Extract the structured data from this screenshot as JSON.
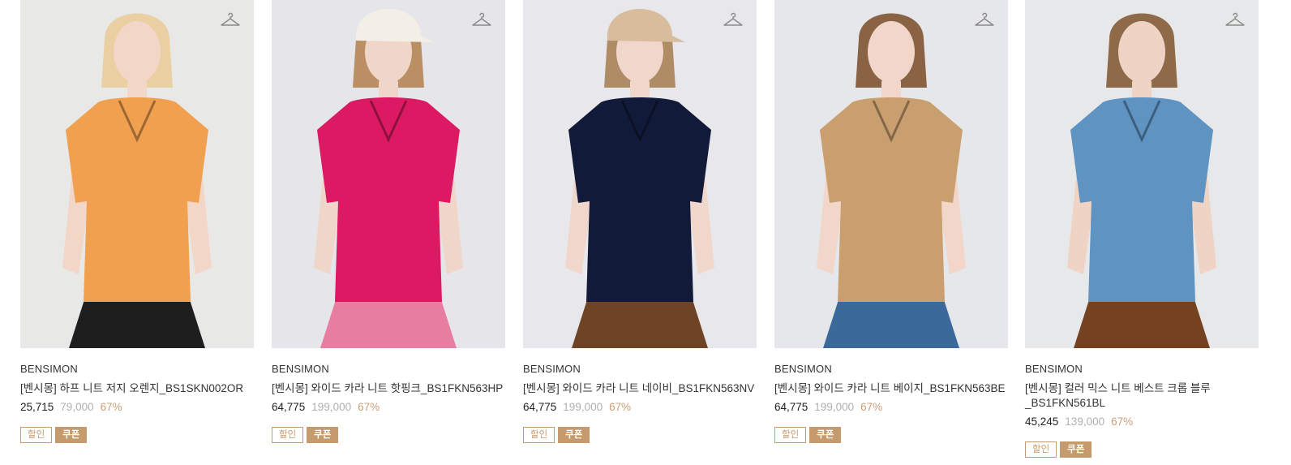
{
  "products": [
    {
      "brand": "BENSIMON",
      "name": "[벤시몽] 하프 니트 저지 오렌지_BS1SKN002OR",
      "price_sale": "25,715",
      "price_original": "79,000",
      "discount_rate": "67%",
      "badges": {
        "sale": "할인",
        "coupon": "쿠폰"
      },
      "colors": {
        "bg": "#e8e8e6",
        "top": "#f0a04f",
        "bottom": "#1e1e1e",
        "skin": "#f2d6c8",
        "hair": "#e9cfa1"
      }
    },
    {
      "brand": "BENSIMON",
      "name": "[벤시몽] 와이드 카라 니트 핫핑크_BS1FKN563HP",
      "price_sale": "64,775",
      "price_original": "199,000",
      "discount_rate": "67%",
      "badges": {
        "sale": "할인",
        "coupon": "쿠폰"
      },
      "colors": {
        "bg": "#e6e6ea",
        "top": "#dc1a63",
        "bottom": "#e87da2",
        "skin": "#f0d5c9",
        "hair": "#b98f63",
        "cap": "#f3eee6"
      }
    },
    {
      "brand": "BENSIMON",
      "name": "[벤시몽] 와이드 카라 니트 네이비_BS1FKN563NV",
      "price_sale": "64,775",
      "price_original": "199,000",
      "discount_rate": "67%",
      "badges": {
        "sale": "할인",
        "coupon": "쿠폰"
      },
      "colors": {
        "bg": "#e8e8ec",
        "top": "#121a3a",
        "bottom": "#6e4424",
        "skin": "#f1d7cb",
        "hair": "#b08c66",
        "cap": "#d8bd9c"
      }
    },
    {
      "brand": "BENSIMON",
      "name": "[벤시몽] 와이드 카라 니트 베이지_BS1FKN563BE",
      "price_sale": "64,775",
      "price_original": "199,000",
      "discount_rate": "67%",
      "badges": {
        "sale": "할인",
        "coupon": "쿠폰"
      },
      "colors": {
        "bg": "#e6e7ea",
        "top": "#c99f6f",
        "bottom": "#3b6a9a",
        "skin": "#f1d6c9",
        "hair": "#8a6344"
      }
    },
    {
      "brand": "BENSIMON",
      "name": "[벤시몽] 컬러 믹스 니트 베스트 크롭 블루_BS1FKN561BL",
      "price_sale": "45,245",
      "price_original": "139,000",
      "discount_rate": "67%",
      "badges": {
        "sale": "할인",
        "coupon": "쿠폰"
      },
      "colors": {
        "bg": "#e7e8ea",
        "top": "#5f93c2",
        "bottom": "#75421f",
        "skin": "#efd3c4",
        "hair": "#8f6a48"
      }
    }
  ]
}
